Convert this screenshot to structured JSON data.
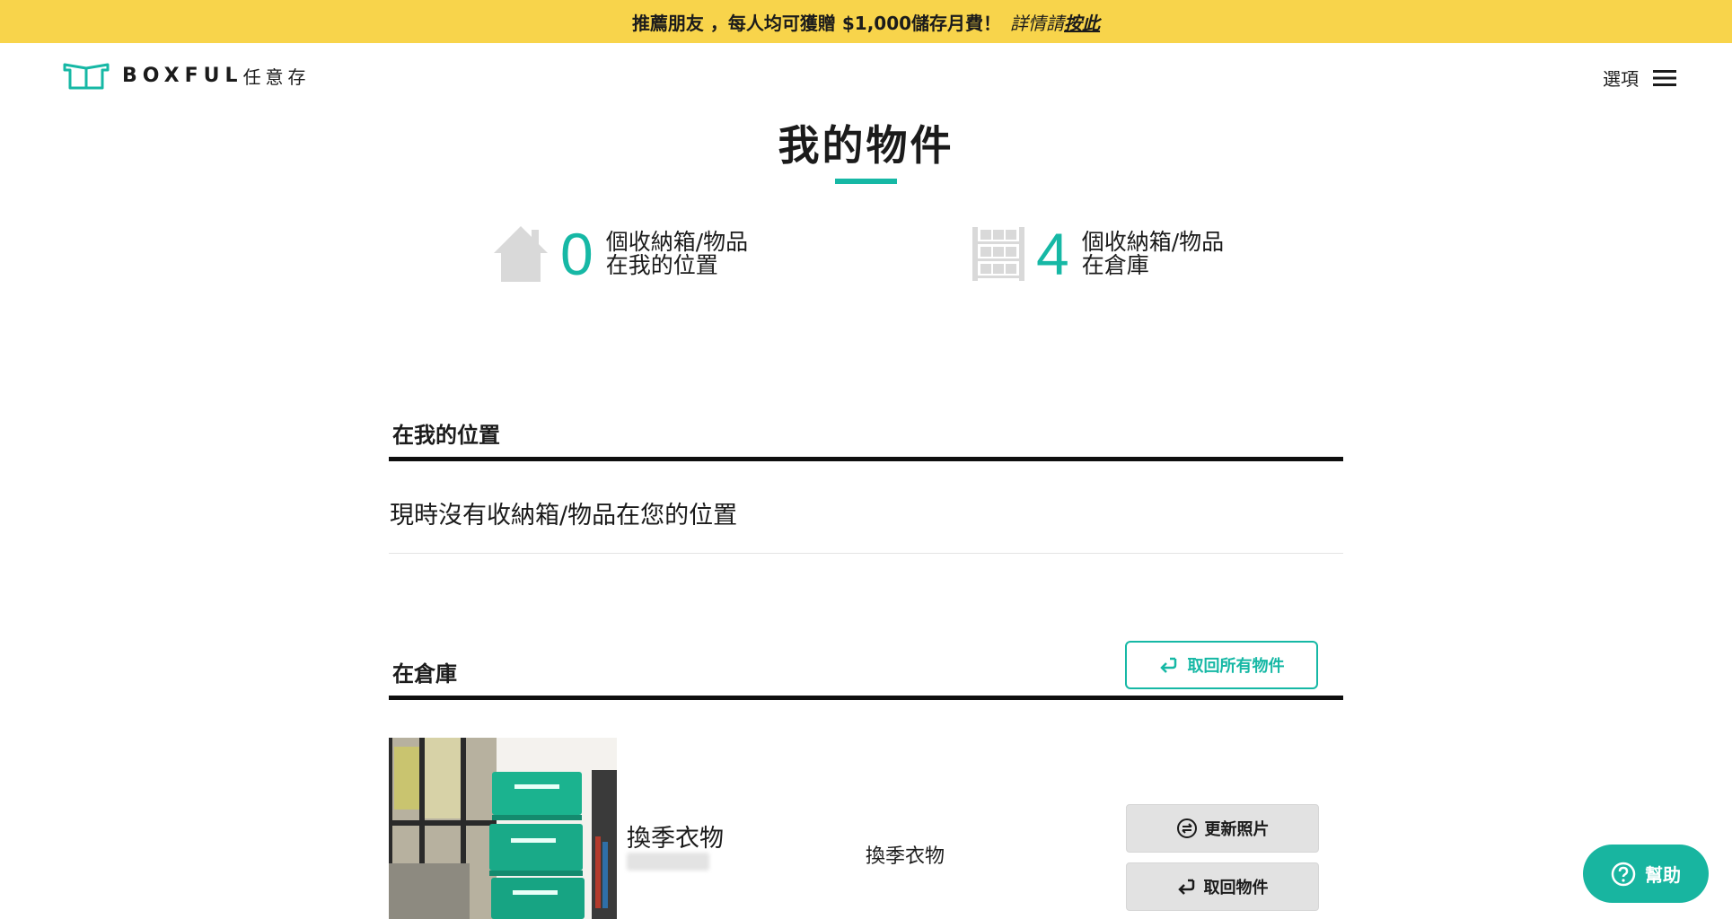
{
  "promo": {
    "text": "推薦朋友 ，每人均可獲贈 $1,000儲存月費！",
    "more": "詳情請",
    "link": "按此"
  },
  "header": {
    "logo_text": "BOXFUL",
    "logo_sub": "任意存",
    "menu_label": "選項"
  },
  "page": {
    "title": "我的物件"
  },
  "stats": [
    {
      "icon": "house-icon",
      "count": "0",
      "line1": "個收納箱/物品",
      "line2": "在我的位置"
    },
    {
      "icon": "warehouse-shelf-icon",
      "count": "4",
      "line1": "個收納箱/物品",
      "line2": "在倉庫"
    }
  ],
  "my_location": {
    "title": "在我的位置",
    "empty_message": "現時沒有收納箱/物品在您的位置"
  },
  "warehouse": {
    "title": "在倉庫",
    "retrieve_all_label": "取回所有物件",
    "items": [
      {
        "name": "換季衣物",
        "description": "換季衣物",
        "update_photo_label": "更新照片",
        "retrieve_label": "取回物件"
      }
    ]
  },
  "help": {
    "label": "幫助"
  },
  "colors": {
    "accent": "#16b8a5",
    "promo_bg": "#f8d44b",
    "help_bg": "#18b5a0"
  }
}
